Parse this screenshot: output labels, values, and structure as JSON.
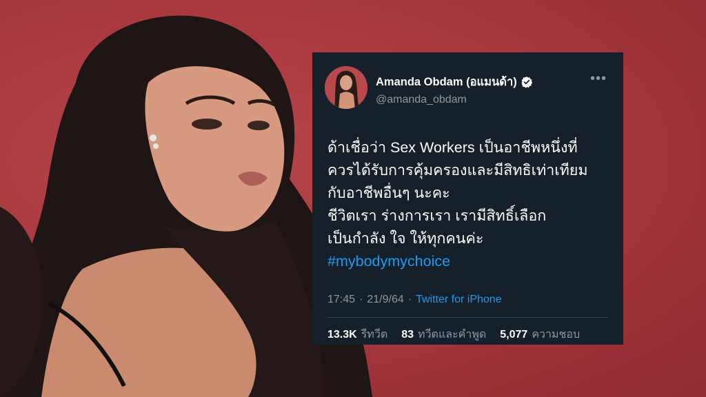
{
  "tweet": {
    "display_name": "Amanda Obdam (อแมนด้า)",
    "handle": "@amanda_obdam",
    "lines": [
      "ด้าเชื่อว่า Sex Workers เป็นอาชีพหนึ่งที่",
      "ควรได้รับการคุ้มครองและมีสิทธิเท่าเทียม",
      "กับอาชีพอื่นๆ นะคะ",
      "ชีวิตเรา ร่างการเรา เรามีสิทธิ์เลือก",
      "เป็นกำลัง ใจ ให้ทุกคนค่ะ"
    ],
    "hashtag": "#mybodymychoice",
    "time": "17:45",
    "date": "21/9/64",
    "separator": "·",
    "source": "Twitter for iPhone",
    "more_icon": "more-horizontal-icon",
    "verified_icon": "verified-badge-icon",
    "stats": {
      "retweets_count": "13.3K",
      "retweets_label": "รีทวีต",
      "quotes_count": "83",
      "quotes_label": "ทวีตและคำพูด",
      "likes_count": "5,077",
      "likes_label": "ความชอบ"
    }
  },
  "colors": {
    "background": "#a3363c",
    "card": "#15202b",
    "link": "#1d9bf0",
    "secondary_text": "#8b98a5",
    "divider": "#38444d"
  }
}
